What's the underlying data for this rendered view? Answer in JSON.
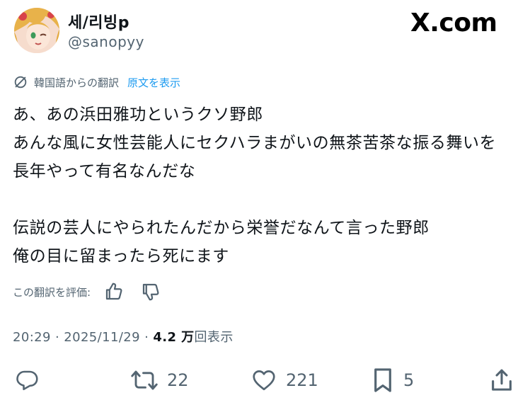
{
  "header": {
    "display_name": "세/리빙p",
    "handle": "@sanopyy",
    "brand": "X.com"
  },
  "translation": {
    "source_label": "韓国語からの翻訳",
    "show_original": "原文を表示"
  },
  "tweet": {
    "lines": [
      "あ、あの浜田雅功というクソ野郎",
      "あんな風に女性芸能人にセクハラまがいの無茶苦茶な振る舞いを",
      "長年やって有名なんだな",
      "",
      "伝説の芸人にやられたんだから栄誉だなんて言った野郎",
      "俺の目に留まったら死にます"
    ]
  },
  "rating": {
    "label": "この翻訳を評価:"
  },
  "meta": {
    "time": "20:29",
    "separator": "·",
    "date": "2025/11/29",
    "views_count": "4.2 万",
    "views_label": "回表示"
  },
  "actions": {
    "reply_count": "",
    "retweet_count": "22",
    "like_count": "221",
    "bookmark_count": "5"
  },
  "colors": {
    "text": "#0f1419",
    "secondary": "#536471",
    "link": "#1d9bf0"
  }
}
